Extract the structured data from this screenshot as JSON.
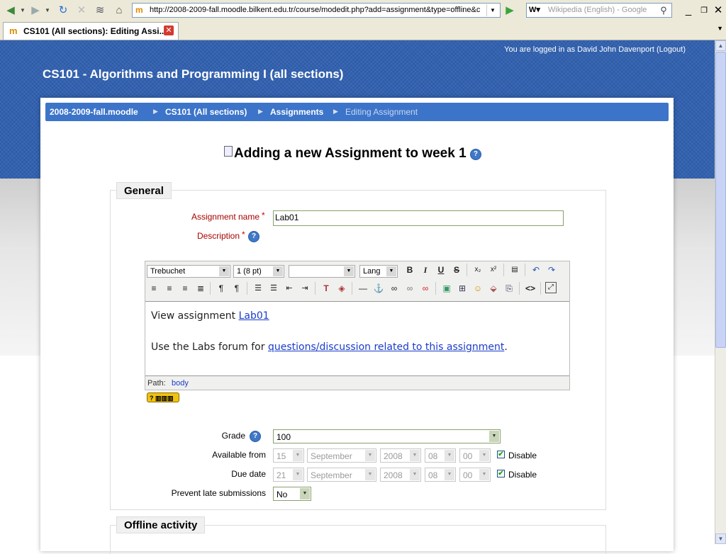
{
  "browser": {
    "url": "http://2008-2009-fall.moodle.bilkent.edu.tr/course/modedit.php?add=assignment&type=offline&c",
    "search_placeholder": "Wikipedia (English) - Google",
    "tab_title": "CS101 (All sections): Editing Assi...",
    "icons": [
      "back-icon",
      "forward-icon",
      "reload-icon",
      "stop-icon",
      "history-icon",
      "home-icon",
      "go-icon",
      "search-icon",
      "minimize-icon",
      "restore-icon",
      "close-icon"
    ]
  },
  "page": {
    "login_info": "You are logged in as David John Davenport (Logout)",
    "course_title": "CS101 - Algorithms and Programming I (all sections)",
    "breadcrumb": [
      {
        "label": "2008-2009-fall.moodle"
      },
      {
        "label": "CS101 (All sections)"
      },
      {
        "label": "Assignments"
      },
      {
        "label": "Editing Assignment"
      }
    ],
    "heading": "Adding a new Assignment to week 1",
    "colors": {
      "header_bg": "#2a5aa9",
      "navbar_bg": "#3c74c9",
      "required_label": "#aa0000"
    }
  },
  "general": {
    "legend": "General",
    "assignment_name_label": "Assignment name",
    "assignment_name_value": "Lab01",
    "description_label": "Description",
    "required_mark": "*",
    "help_mark": "?"
  },
  "editor": {
    "font_family": "Trebuchet",
    "font_size": "1 (8 pt)",
    "format": "",
    "lang": "Lang",
    "content_line1_prefix": "View assignment ",
    "content_line1_link": "Lab01",
    "content_line2_prefix": "Use the Labs forum for ",
    "content_line2_link": "questions/discussion related to this assignment",
    "content_line2_suffix": ".",
    "path_label": "Path:",
    "path_value": "body"
  },
  "grading": {
    "grade_label": "Grade",
    "grade_value": "100",
    "available_from_label": "Available from",
    "available_from": {
      "day": "15",
      "month": "September",
      "year": "2008",
      "hour": "08",
      "minute": "00"
    },
    "due_date_label": "Due date",
    "due_date": {
      "day": "21",
      "month": "September",
      "year": "2008",
      "hour": "08",
      "minute": "00"
    },
    "disable_label": "Disable",
    "disable_checked": true,
    "prevent_late_label": "Prevent late submissions",
    "prevent_late_value": "No"
  },
  "offline": {
    "legend": "Offline activity"
  }
}
